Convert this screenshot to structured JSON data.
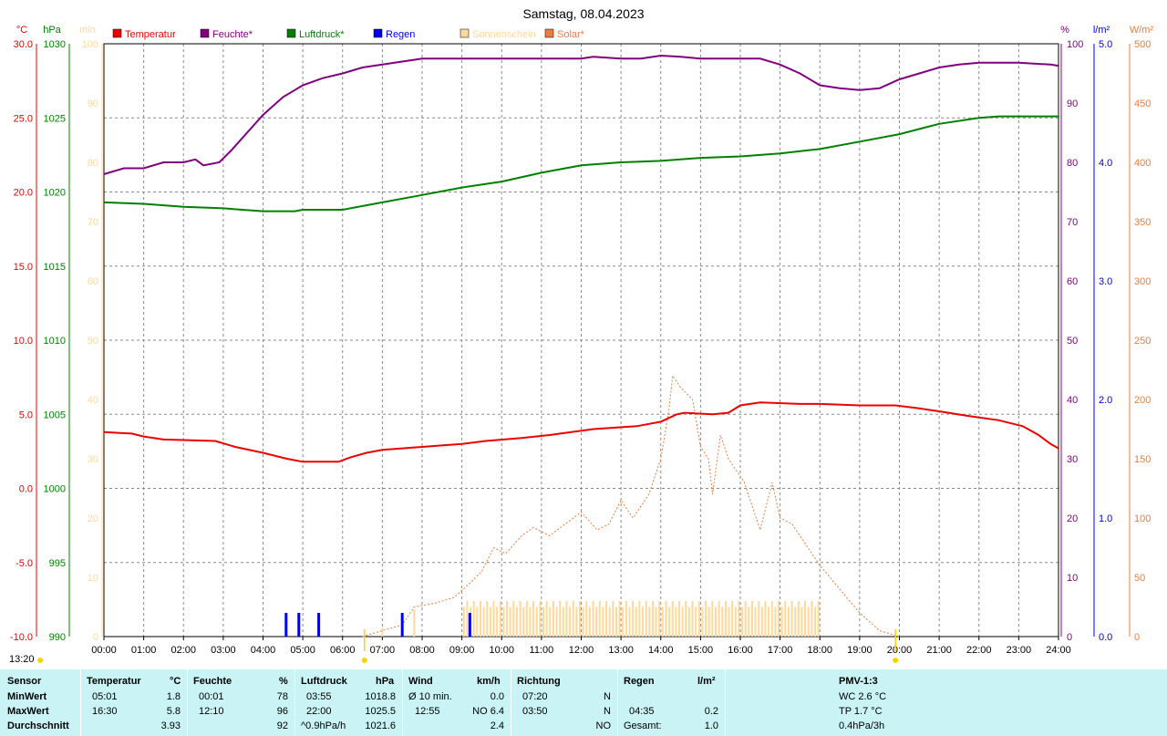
{
  "title": "Samstag, 08.04.2023",
  "legend": [
    {
      "label": "Temperatur",
      "color": "#ee0000",
      "text_color": "#ee0000"
    },
    {
      "label": "Feuchte*",
      "color": "#800080",
      "text_color": "#800080"
    },
    {
      "label": "Luftdruck*",
      "color": "#008000",
      "text_color": "#008000"
    },
    {
      "label": "Regen",
      "color": "#0000ee",
      "text_color": "#0000ee"
    },
    {
      "label": "Sonnenschein",
      "color": "#ffd89a",
      "text_color": "#ffd89a"
    },
    {
      "label": "Solar*",
      "color": "#f07b3a",
      "text_color": "#f07b3a"
    }
  ],
  "axis_units": {
    "temp": "°C",
    "pressure": "hPa",
    "sun": "min",
    "humidity": "%",
    "rain": "l/m²",
    "solar": "W/m²"
  },
  "colors": {
    "temp": "#ee0000",
    "humidity": "#800080",
    "pressure": "#008000",
    "rain": "#0000ee",
    "sun": "#ffd89a",
    "solar": "#f07b3a",
    "sun_axis": "#ffd89a",
    "solar_axis": "#f07b3a",
    "footer_bg": "#c9f3f5"
  },
  "status_time": "13:20",
  "chart_data": {
    "type": "line",
    "title": "Samstag, 08.04.2023",
    "x_ticks": [
      "00:00",
      "01:00",
      "02:00",
      "03:00",
      "04:00",
      "05:00",
      "06:00",
      "07:00",
      "08:00",
      "09:00",
      "10:00",
      "11:00",
      "12:00",
      "13:00",
      "14:00",
      "15:00",
      "16:00",
      "17:00",
      "18:00",
      "19:00",
      "20:00",
      "21:00",
      "22:00",
      "23:00",
      "24:00"
    ],
    "x_range_hours": [
      0,
      24
    ],
    "grid": true,
    "axes": {
      "temp": {
        "range": [
          -10,
          30
        ],
        "ticks": [
          "30.0",
          "25.0",
          "20.0",
          "15.0",
          "10.0",
          "5.0",
          "0.0",
          "-5.0",
          "-10.0"
        ]
      },
      "pressure": {
        "range": [
          990,
          1030
        ],
        "ticks": [
          "1030",
          "1025",
          "1020",
          "1015",
          "1010",
          "1005",
          "1000",
          "995",
          "990"
        ]
      },
      "sun": {
        "range": [
          0,
          100
        ],
        "ticks": [
          "100",
          "90",
          "80",
          "70",
          "60",
          "50",
          "40",
          "30",
          "20",
          "10",
          "0"
        ]
      },
      "humidity": {
        "range": [
          0,
          100
        ],
        "ticks": [
          "100",
          "90",
          "80",
          "70",
          "60",
          "50",
          "40",
          "30",
          "20",
          "10",
          "0"
        ]
      },
      "rain": {
        "range": [
          0,
          5
        ],
        "ticks": [
          "5.0",
          "4.0",
          "3.0",
          "2.0",
          "1.0",
          "0.0"
        ]
      },
      "solar": {
        "range": [
          0,
          500
        ],
        "ticks": [
          "500",
          "450",
          "400",
          "350",
          "300",
          "250",
          "200",
          "150",
          "100",
          "50",
          "0"
        ]
      }
    },
    "series": [
      {
        "name": "Temperatur",
        "axis": "temp",
        "points": [
          [
            0,
            3.8
          ],
          [
            0.7,
            3.7
          ],
          [
            1.0,
            3.5
          ],
          [
            1.5,
            3.3
          ],
          [
            2.8,
            3.2
          ],
          [
            3.3,
            2.8
          ],
          [
            4.0,
            2.4
          ],
          [
            4.6,
            2.0
          ],
          [
            5.0,
            1.8
          ],
          [
            5.9,
            1.8
          ],
          [
            6.2,
            2.1
          ],
          [
            6.6,
            2.4
          ],
          [
            7.0,
            2.6
          ],
          [
            8.0,
            2.8
          ],
          [
            9.0,
            3.0
          ],
          [
            9.6,
            3.2
          ],
          [
            10.5,
            3.4
          ],
          [
            11.2,
            3.6
          ],
          [
            12.3,
            4.0
          ],
          [
            13.4,
            4.2
          ],
          [
            14.0,
            4.5
          ],
          [
            14.4,
            5.0
          ],
          [
            14.6,
            5.1
          ],
          [
            15.3,
            5.0
          ],
          [
            15.7,
            5.1
          ],
          [
            16.0,
            5.6
          ],
          [
            16.5,
            5.8
          ],
          [
            17.5,
            5.7
          ],
          [
            18.0,
            5.7
          ],
          [
            19.0,
            5.6
          ],
          [
            19.9,
            5.6
          ],
          [
            20.5,
            5.4
          ],
          [
            21.0,
            5.2
          ],
          [
            21.7,
            4.9
          ],
          [
            22.5,
            4.6
          ],
          [
            23.1,
            4.2
          ],
          [
            23.5,
            3.6
          ],
          [
            23.8,
            3.0
          ],
          [
            24.0,
            2.7
          ]
        ]
      },
      {
        "name": "Feuchte*",
        "axis": "humidity",
        "points": [
          [
            0,
            78
          ],
          [
            0.5,
            79
          ],
          [
            1.0,
            79
          ],
          [
            1.5,
            80
          ],
          [
            2.0,
            80
          ],
          [
            2.3,
            80.5
          ],
          [
            2.5,
            79.5
          ],
          [
            2.9,
            80
          ],
          [
            3.2,
            82
          ],
          [
            3.6,
            85
          ],
          [
            4.0,
            88
          ],
          [
            4.5,
            91
          ],
          [
            5.0,
            93
          ],
          [
            5.5,
            94.2
          ],
          [
            6.0,
            95
          ],
          [
            6.5,
            96
          ],
          [
            7.0,
            96.5
          ],
          [
            7.5,
            97
          ],
          [
            8.0,
            97.5
          ],
          [
            9.0,
            97.5
          ],
          [
            10.0,
            97.5
          ],
          [
            11.0,
            97.5
          ],
          [
            12.0,
            97.5
          ],
          [
            12.3,
            97.8
          ],
          [
            13.0,
            97.5
          ],
          [
            13.5,
            97.5
          ],
          [
            14.0,
            98
          ],
          [
            14.5,
            97.8
          ],
          [
            15.0,
            97.5
          ],
          [
            16.0,
            97.5
          ],
          [
            16.5,
            97.5
          ],
          [
            17.0,
            96.5
          ],
          [
            17.5,
            95
          ],
          [
            18.0,
            93
          ],
          [
            18.5,
            92.5
          ],
          [
            19.0,
            92.2
          ],
          [
            19.5,
            92.5
          ],
          [
            20.0,
            94
          ],
          [
            20.5,
            95
          ],
          [
            21.0,
            96
          ],
          [
            21.5,
            96.5
          ],
          [
            22.0,
            96.8
          ],
          [
            23.0,
            96.8
          ],
          [
            23.8,
            96.5
          ],
          [
            24.0,
            96.3
          ]
        ]
      },
      {
        "name": "Luftdruck*",
        "axis": "pressure",
        "points": [
          [
            0,
            1019.3
          ],
          [
            1.0,
            1019.2
          ],
          [
            2.0,
            1019.0
          ],
          [
            3.0,
            1018.9
          ],
          [
            4.0,
            1018.7
          ],
          [
            4.8,
            1018.7
          ],
          [
            5.0,
            1018.8
          ],
          [
            6.0,
            1018.8
          ],
          [
            7.0,
            1019.3
          ],
          [
            8.0,
            1019.8
          ],
          [
            9.0,
            1020.3
          ],
          [
            10.0,
            1020.7
          ],
          [
            11.0,
            1021.3
          ],
          [
            12.0,
            1021.8
          ],
          [
            13.0,
            1022.0
          ],
          [
            14.0,
            1022.1
          ],
          [
            15.0,
            1022.3
          ],
          [
            16.0,
            1022.4
          ],
          [
            17.0,
            1022.6
          ],
          [
            18.0,
            1022.9
          ],
          [
            19.0,
            1023.4
          ],
          [
            20.0,
            1023.9
          ],
          [
            21.0,
            1024.6
          ],
          [
            22.0,
            1025.0
          ],
          [
            22.5,
            1025.1
          ],
          [
            23.0,
            1025.1
          ],
          [
            24.0,
            1025.1
          ]
        ]
      },
      {
        "name": "Solar*",
        "axis": "solar",
        "dashed": true,
        "points": [
          [
            6.5,
            0
          ],
          [
            7.0,
            5
          ],
          [
            7.5,
            10
          ],
          [
            7.8,
            25
          ],
          [
            8.3,
            28
          ],
          [
            8.8,
            33
          ],
          [
            9.2,
            45
          ],
          [
            9.5,
            55
          ],
          [
            9.8,
            75
          ],
          [
            10.1,
            70
          ],
          [
            10.5,
            85
          ],
          [
            10.8,
            92
          ],
          [
            11.2,
            85
          ],
          [
            11.6,
            95
          ],
          [
            12.0,
            105
          ],
          [
            12.4,
            90
          ],
          [
            12.7,
            95
          ],
          [
            13.0,
            115
          ],
          [
            13.3,
            100
          ],
          [
            13.7,
            120
          ],
          [
            14.0,
            150
          ],
          [
            14.2,
            190
          ],
          [
            14.3,
            220
          ],
          [
            14.5,
            210
          ],
          [
            14.8,
            200
          ],
          [
            15.0,
            160
          ],
          [
            15.2,
            150
          ],
          [
            15.3,
            120
          ],
          [
            15.5,
            170
          ],
          [
            15.7,
            150
          ],
          [
            15.9,
            140
          ],
          [
            16.1,
            130
          ],
          [
            16.3,
            110
          ],
          [
            16.5,
            90
          ],
          [
            16.8,
            130
          ],
          [
            17.0,
            100
          ],
          [
            17.3,
            95
          ],
          [
            17.6,
            80
          ],
          [
            18.0,
            60
          ],
          [
            18.5,
            40
          ],
          [
            19.0,
            20
          ],
          [
            19.5,
            5
          ],
          [
            20.0,
            0
          ]
        ]
      }
    ],
    "rain_bars": [
      {
        "x": 4.58,
        "value": 0.2
      },
      {
        "x": 4.9,
        "value": 0.2
      },
      {
        "x": 5.4,
        "value": 0.2
      },
      {
        "x": 7.5,
        "value": 0.2
      },
      {
        "x": 9.2,
        "value": 0.2
      }
    ],
    "sunshine": {
      "start": 9.0,
      "end": 18.0,
      "value": 6,
      "note_range": [
        5,
        6
      ]
    },
    "markers": [
      {
        "x": 6.55,
        "label": "sunrise"
      },
      {
        "x": 19.9,
        "label": "sunset"
      }
    ]
  },
  "footer": {
    "headers": {
      "sensor": "Sensor",
      "temp": "Temperatur",
      "temp_unit": "°C",
      "hum": "Feuchte",
      "hum_unit": "%",
      "press": "Luftdruck",
      "press_unit": "hPa",
      "wind": "Wind",
      "wind_unit": "km/h",
      "dir": "Richtung",
      "rain": "Regen",
      "rain_unit": "l/m²",
      "pmv": "PMV-1:3"
    },
    "rows": {
      "min": {
        "label": "MinWert",
        "temp_time": "05:01",
        "temp_val": "1.8",
        "hum_time": "00:01",
        "hum_val": "78",
        "press_time": "03:55",
        "press_val": "1018.8",
        "wind_label": "Ø 10 min.",
        "wind_val": "0.0",
        "dir_time": "07:20",
        "dir_val": "N",
        "rain_time": "",
        "rain_val": "",
        "pmv": "WC 2.6 °C"
      },
      "max": {
        "label": "MaxWert",
        "temp_time": "16:30",
        "temp_val": "5.8",
        "hum_time": "12:10",
        "hum_val": "96",
        "press_time": "22:00",
        "press_val": "1025.5",
        "wind_label": "12:55",
        "wind_val": "NO 6.4",
        "dir_time": "03:50",
        "dir_val": "N",
        "rain_time": "04:35",
        "rain_val": "0.2",
        "pmv": "TP 1.7 °C"
      },
      "avg": {
        "label": "Durchschnitt",
        "temp_time": "",
        "temp_val": "3.93",
        "hum_time": "",
        "hum_val": "92",
        "press_time": "^0.9hPa/h",
        "press_val": "1021.6",
        "wind_label": "",
        "wind_val": "2.4",
        "dir_time": "",
        "dir_val": "NO",
        "rain_time": "Gesamt:",
        "rain_val": "1.0",
        "pmv": "0.4hPa/3h"
      }
    }
  }
}
